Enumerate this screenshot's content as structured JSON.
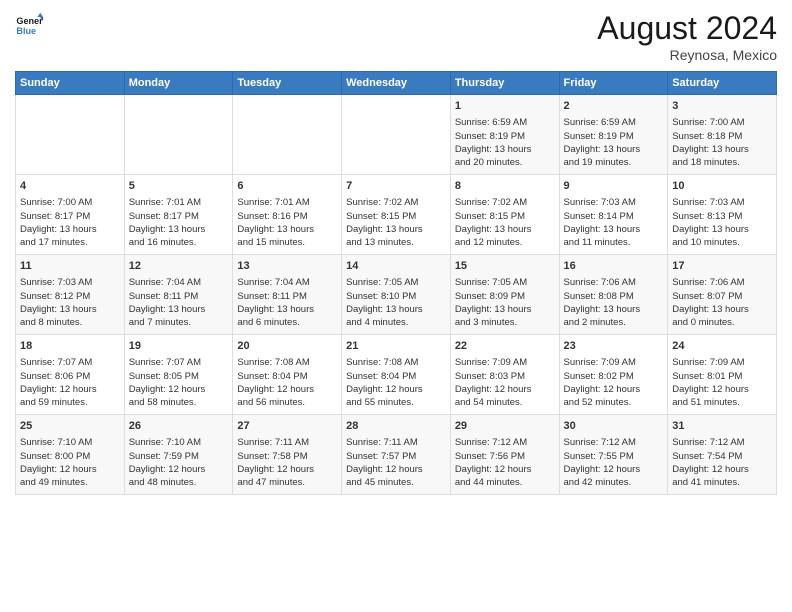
{
  "logo": {
    "line1": "General",
    "line2": "Blue"
  },
  "title": "August 2024",
  "location": "Reynosa, Mexico",
  "days_of_week": [
    "Sunday",
    "Monday",
    "Tuesday",
    "Wednesday",
    "Thursday",
    "Friday",
    "Saturday"
  ],
  "weeks": [
    [
      {
        "day": "",
        "content": ""
      },
      {
        "day": "",
        "content": ""
      },
      {
        "day": "",
        "content": ""
      },
      {
        "day": "",
        "content": ""
      },
      {
        "day": "1",
        "content": "Sunrise: 6:59 AM\nSunset: 8:19 PM\nDaylight: 13 hours\nand 20 minutes."
      },
      {
        "day": "2",
        "content": "Sunrise: 6:59 AM\nSunset: 8:19 PM\nDaylight: 13 hours\nand 19 minutes."
      },
      {
        "day": "3",
        "content": "Sunrise: 7:00 AM\nSunset: 8:18 PM\nDaylight: 13 hours\nand 18 minutes."
      }
    ],
    [
      {
        "day": "4",
        "content": "Sunrise: 7:00 AM\nSunset: 8:17 PM\nDaylight: 13 hours\nand 17 minutes."
      },
      {
        "day": "5",
        "content": "Sunrise: 7:01 AM\nSunset: 8:17 PM\nDaylight: 13 hours\nand 16 minutes."
      },
      {
        "day": "6",
        "content": "Sunrise: 7:01 AM\nSunset: 8:16 PM\nDaylight: 13 hours\nand 15 minutes."
      },
      {
        "day": "7",
        "content": "Sunrise: 7:02 AM\nSunset: 8:15 PM\nDaylight: 13 hours\nand 13 minutes."
      },
      {
        "day": "8",
        "content": "Sunrise: 7:02 AM\nSunset: 8:15 PM\nDaylight: 13 hours\nand 12 minutes."
      },
      {
        "day": "9",
        "content": "Sunrise: 7:03 AM\nSunset: 8:14 PM\nDaylight: 13 hours\nand 11 minutes."
      },
      {
        "day": "10",
        "content": "Sunrise: 7:03 AM\nSunset: 8:13 PM\nDaylight: 13 hours\nand 10 minutes."
      }
    ],
    [
      {
        "day": "11",
        "content": "Sunrise: 7:03 AM\nSunset: 8:12 PM\nDaylight: 13 hours\nand 8 minutes."
      },
      {
        "day": "12",
        "content": "Sunrise: 7:04 AM\nSunset: 8:11 PM\nDaylight: 13 hours\nand 7 minutes."
      },
      {
        "day": "13",
        "content": "Sunrise: 7:04 AM\nSunset: 8:11 PM\nDaylight: 13 hours\nand 6 minutes."
      },
      {
        "day": "14",
        "content": "Sunrise: 7:05 AM\nSunset: 8:10 PM\nDaylight: 13 hours\nand 4 minutes."
      },
      {
        "day": "15",
        "content": "Sunrise: 7:05 AM\nSunset: 8:09 PM\nDaylight: 13 hours\nand 3 minutes."
      },
      {
        "day": "16",
        "content": "Sunrise: 7:06 AM\nSunset: 8:08 PM\nDaylight: 13 hours\nand 2 minutes."
      },
      {
        "day": "17",
        "content": "Sunrise: 7:06 AM\nSunset: 8:07 PM\nDaylight: 13 hours\nand 0 minutes."
      }
    ],
    [
      {
        "day": "18",
        "content": "Sunrise: 7:07 AM\nSunset: 8:06 PM\nDaylight: 12 hours\nand 59 minutes."
      },
      {
        "day": "19",
        "content": "Sunrise: 7:07 AM\nSunset: 8:05 PM\nDaylight: 12 hours\nand 58 minutes."
      },
      {
        "day": "20",
        "content": "Sunrise: 7:08 AM\nSunset: 8:04 PM\nDaylight: 12 hours\nand 56 minutes."
      },
      {
        "day": "21",
        "content": "Sunrise: 7:08 AM\nSunset: 8:04 PM\nDaylight: 12 hours\nand 55 minutes."
      },
      {
        "day": "22",
        "content": "Sunrise: 7:09 AM\nSunset: 8:03 PM\nDaylight: 12 hours\nand 54 minutes."
      },
      {
        "day": "23",
        "content": "Sunrise: 7:09 AM\nSunset: 8:02 PM\nDaylight: 12 hours\nand 52 minutes."
      },
      {
        "day": "24",
        "content": "Sunrise: 7:09 AM\nSunset: 8:01 PM\nDaylight: 12 hours\nand 51 minutes."
      }
    ],
    [
      {
        "day": "25",
        "content": "Sunrise: 7:10 AM\nSunset: 8:00 PM\nDaylight: 12 hours\nand 49 minutes."
      },
      {
        "day": "26",
        "content": "Sunrise: 7:10 AM\nSunset: 7:59 PM\nDaylight: 12 hours\nand 48 minutes."
      },
      {
        "day": "27",
        "content": "Sunrise: 7:11 AM\nSunset: 7:58 PM\nDaylight: 12 hours\nand 47 minutes."
      },
      {
        "day": "28",
        "content": "Sunrise: 7:11 AM\nSunset: 7:57 PM\nDaylight: 12 hours\nand 45 minutes."
      },
      {
        "day": "29",
        "content": "Sunrise: 7:12 AM\nSunset: 7:56 PM\nDaylight: 12 hours\nand 44 minutes."
      },
      {
        "day": "30",
        "content": "Sunrise: 7:12 AM\nSunset: 7:55 PM\nDaylight: 12 hours\nand 42 minutes."
      },
      {
        "day": "31",
        "content": "Sunrise: 7:12 AM\nSunset: 7:54 PM\nDaylight: 12 hours\nand 41 minutes."
      }
    ]
  ]
}
